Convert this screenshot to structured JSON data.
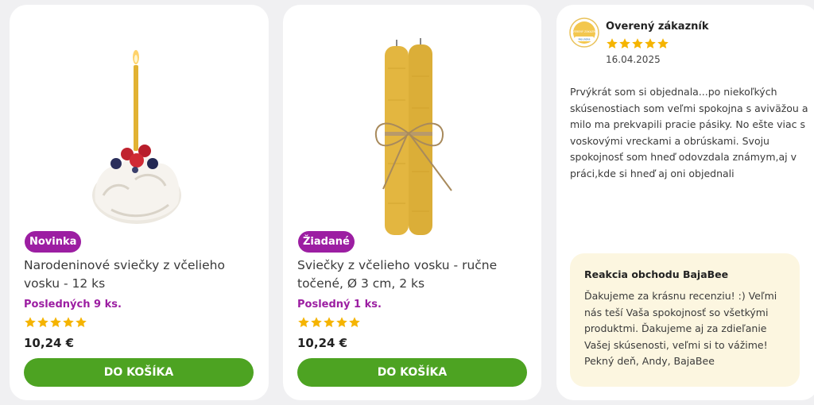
{
  "products": [
    {
      "badge": "Novinka",
      "title": "Narodeninové sviečky z včelieho vosku - 12 ks",
      "stock": "Posledných 9 ks.",
      "rating": 5,
      "price": "10,24 €",
      "button": "DO KOŠÍKA"
    },
    {
      "badge": "Žiadané",
      "title": "Sviečky z včelieho vosku - ručne točené, Ø 3 cm, 2 ks",
      "stock": "Posledný 1 ks.",
      "rating": 5,
      "price": "10,24 €",
      "button": "DO KOŠÍKA"
    }
  ],
  "review": {
    "seal_text": "OVERENÝ ZÁKAZNÍK",
    "seal_brand": "Heureka",
    "author": "Overený zákazník",
    "rating": 5,
    "date": "16.04.2025",
    "text": "Prvýkrát som si objednala...po niekoľkých skúsenostiach som veľmi spokojna s aviväžou a milo ma prekvapili pracie pásiky. No ešte viac s voskovými vreckami a obrúskami. Svoju spokojnosť som hneď odovzdala známym,aj v práci,kde si hneď aj oni objednali",
    "reply": {
      "title": "Reakcia obchodu BajaBee",
      "text": "Ďakujeme za krásnu recenziu! :) Veľmi nás teší Vaša spokojnosť so všetkými produktmi. Ďakujeme aj za zdieľanie Vašej skúsenosti, veľmi si to vážime! Pekný deň, Andy, BajaBee"
    }
  },
  "colors": {
    "badge": "#9c1ea2",
    "button": "#4da322",
    "star": "#f5b400",
    "reply_bg": "#fcf6e0"
  },
  "icons": [
    "star-icon",
    "verified-customer-seal-icon"
  ]
}
